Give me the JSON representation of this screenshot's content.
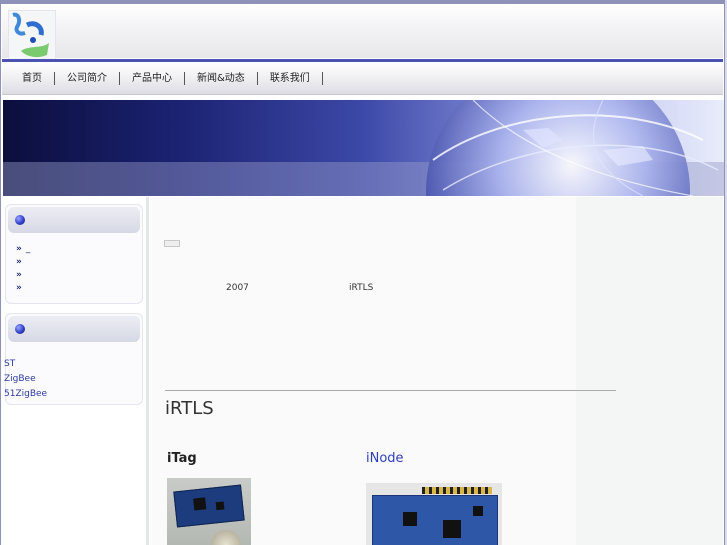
{
  "nav": {
    "items": [
      {
        "label": "首页"
      },
      {
        "label": "公司简介"
      },
      {
        "label": "产品中心"
      },
      {
        "label": "新闻&动态"
      },
      {
        "label": "联系我们"
      }
    ]
  },
  "sidebar": {
    "list_items": [
      {
        "raquo": "»",
        "label": "_"
      },
      {
        "raquo": "»",
        "label": ""
      },
      {
        "raquo": "»",
        "label": ""
      },
      {
        "raquo": "»",
        "label": ""
      }
    ],
    "links": [
      {
        "label": "ST"
      },
      {
        "label": "ZigBee"
      },
      {
        "label": "51ZigBee"
      }
    ]
  },
  "main": {
    "year_text": "2007",
    "brand_text": "iRTLS",
    "section_title": "iRTLS",
    "products": [
      {
        "name": "iTag"
      },
      {
        "name": "iNode"
      }
    ]
  },
  "colors": {
    "accent": "#4a52b4",
    "link": "#2d3fb8"
  }
}
